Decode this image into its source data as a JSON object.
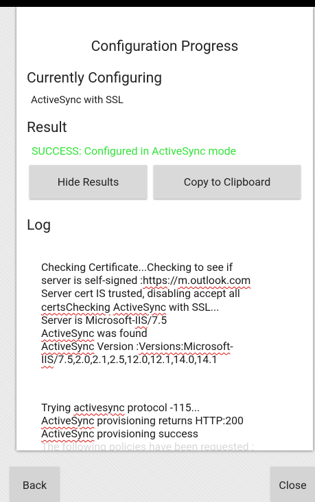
{
  "dialog": {
    "title": "Configuration Progress",
    "currently_configuring_heading": "Currently Configuring",
    "currently_configuring_value": "ActiveSync with SSL",
    "result_heading": "Result",
    "result_value": "SUCCESS: Configured in ActiveSync mode",
    "buttons": {
      "hide_results": "Hide Results",
      "copy_clipboard": "Copy to Clipboard"
    },
    "log_heading": "Log",
    "log": {
      "l1": "Checking Certificate...Checking to see if",
      "l2a": "server is self-signed :",
      "l2b": "https",
      "l2c": "://",
      "l2d": "m.outlook.com",
      "l3": "Server cert IS trusted, disabling accept all",
      "l4a": "certsChecking",
      "l4b": " ",
      "l4c": "ActiveSync",
      "l4d": " with SSL...",
      "l5a": "Server is Microsoft-",
      "l5b": "IIS",
      "l5c": "/7.5",
      "l6a": "ActiveSync",
      "l6b": " was found",
      "l7a": "ActiveSync",
      "l7b": " Version :",
      "l7c": "Versions:Microsoft",
      "l7d": "-",
      "l8a": "IIS",
      "l8b": "/7.5,2.0,2.1,2.5,12.0,12.1,14.0,14.1",
      "l9a": "Trying ",
      "l9b": "activesync",
      "l9c": " protocol -115...",
      "l10a": "ActiveSync",
      "l10b": " provisioning returns HTTP:200",
      "l11a": "ActiveSync",
      "l11b": " provisioning success",
      "l12": "The following policies have been requested :"
    }
  },
  "footer": {
    "back": "Back",
    "close": "Close"
  }
}
